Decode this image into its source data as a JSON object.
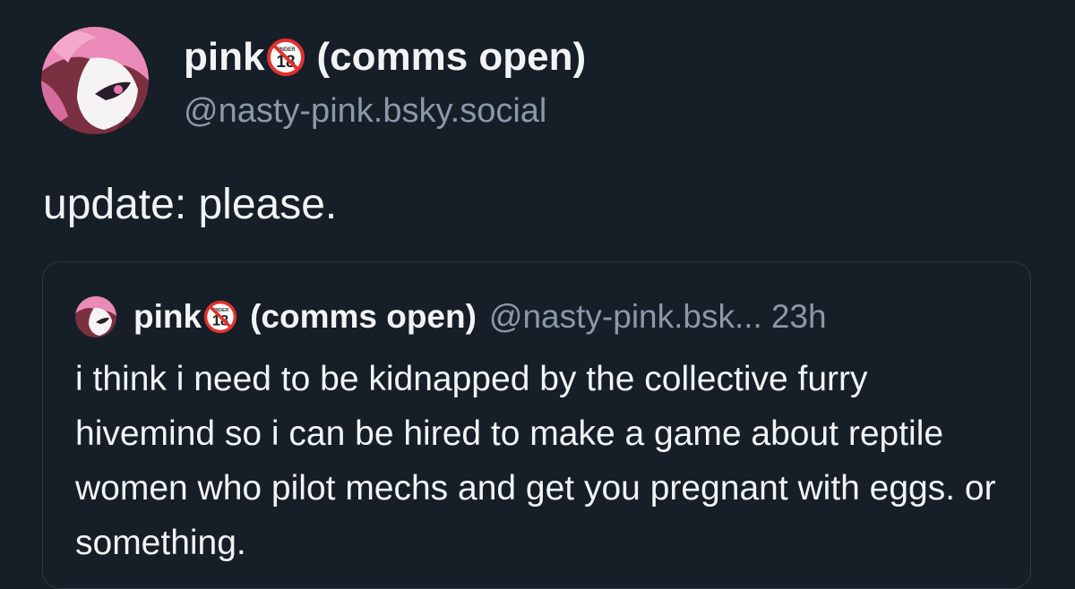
{
  "post": {
    "author_name": "pink",
    "author_name_suffix": "(comms open)",
    "author_handle": "@nasty-pink.bsky.social",
    "badge_icon": "under-18-icon",
    "text": "update: please."
  },
  "quote": {
    "author_name": "pink",
    "author_name_suffix": "(comms open)",
    "author_handle": "@nasty-pink.bsk...",
    "timestamp": "23h",
    "text": "i think i need to be kidnapped by the collective furry hivemind so i can be hired to make a game about reptile women who pilot mechs and get you pregnant with eggs. or something."
  },
  "colors": {
    "background": "#161e27",
    "text": "#f1f3f5",
    "muted": "#8b98a9",
    "border": "#2e3946",
    "badge_red": "#e0322f"
  }
}
